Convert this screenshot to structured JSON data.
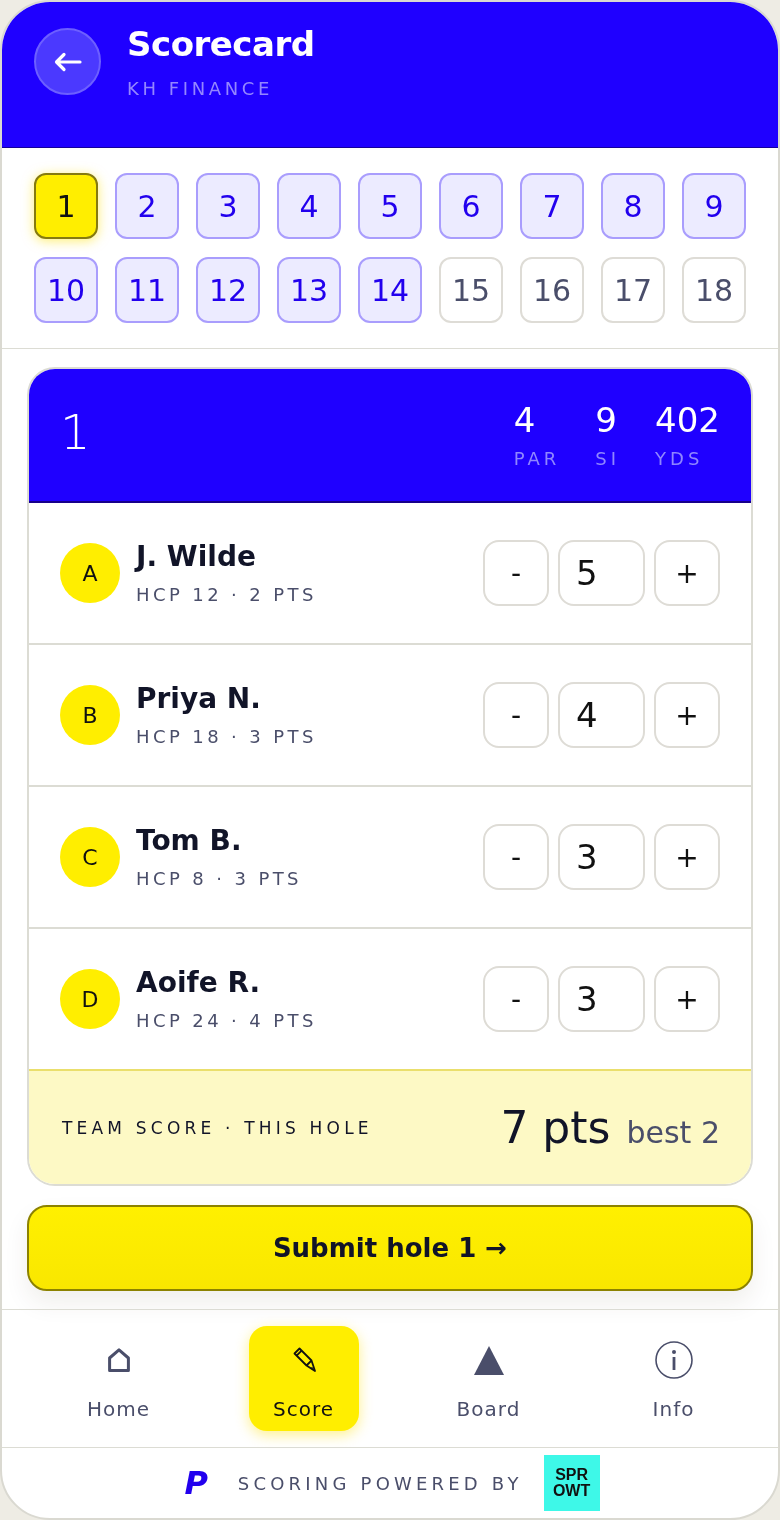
{
  "header": {
    "title": "Scorecard",
    "subtitle": "KH FINANCE"
  },
  "holes": [
    {
      "label": "1",
      "selected": true,
      "scored": true
    },
    {
      "label": "2",
      "selected": false,
      "scored": true
    },
    {
      "label": "3",
      "selected": false,
      "scored": true
    },
    {
      "label": "4",
      "selected": false,
      "scored": true
    },
    {
      "label": "5",
      "selected": false,
      "scored": true
    },
    {
      "label": "6",
      "selected": false,
      "scored": true
    },
    {
      "label": "7",
      "selected": false,
      "scored": true
    },
    {
      "label": "8",
      "selected": false,
      "scored": true
    },
    {
      "label": "9",
      "selected": false,
      "scored": true
    },
    {
      "label": "10",
      "selected": false,
      "scored": true
    },
    {
      "label": "11",
      "selected": false,
      "scored": true
    },
    {
      "label": "12",
      "selected": false,
      "scored": true
    },
    {
      "label": "13",
      "selected": false,
      "scored": true
    },
    {
      "label": "14",
      "selected": false,
      "scored": true
    },
    {
      "label": "15",
      "selected": false,
      "scored": false
    },
    {
      "label": "16",
      "selected": false,
      "scored": false
    },
    {
      "label": "17",
      "selected": false,
      "scored": false
    },
    {
      "label": "18",
      "selected": false,
      "scored": false
    }
  ],
  "hole_card": {
    "number": "1",
    "stats": [
      {
        "value": "4",
        "label": "PAR"
      },
      {
        "value": "9",
        "label": "SI"
      },
      {
        "value": "402",
        "label": "YDS"
      }
    ]
  },
  "players": [
    {
      "avatar": "A",
      "name": "J. Wilde",
      "details": "HCP 12 · 2 PTS",
      "minus": "-",
      "score": "5",
      "plus": "+"
    },
    {
      "avatar": "B",
      "name": "Priya N.",
      "details": "HCP 18 · 3 PTS",
      "minus": "-",
      "score": "4",
      "plus": "+"
    },
    {
      "avatar": "C",
      "name": "Tom B.",
      "details": "HCP 8 · 3 PTS",
      "minus": "-",
      "score": "3",
      "plus": "+"
    },
    {
      "avatar": "D",
      "name": "Aoife R.",
      "details": "HCP 24 · 4 PTS",
      "minus": "-",
      "score": "3",
      "plus": "+"
    }
  ],
  "team_score": {
    "label": "TEAM SCORE · THIS HOLE",
    "points": "7 pts",
    "note": "best 2"
  },
  "submit_button": {
    "label": "Submit hole 1 →"
  },
  "nav": [
    {
      "label": "Home",
      "selected": false
    },
    {
      "label": "Score",
      "selected": true
    },
    {
      "label": "Board",
      "selected": false
    },
    {
      "label": "Info",
      "selected": false
    }
  ],
  "footer": {
    "logo": "P",
    "text": "SCORING POWERED BY",
    "badge": "SPROWT"
  }
}
